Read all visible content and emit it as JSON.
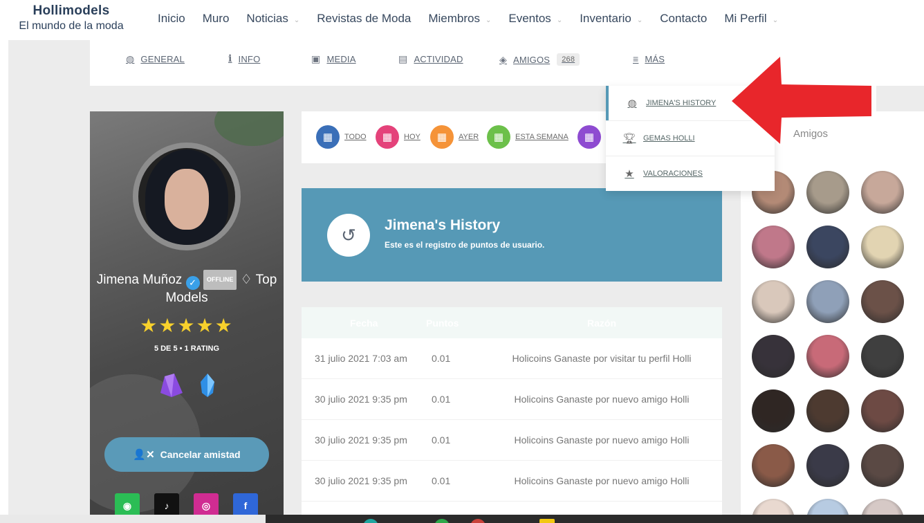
{
  "brand": {
    "title": "Hollimodels",
    "subtitle": "El mundo de la moda"
  },
  "nav": {
    "items": [
      {
        "label": "Inicio",
        "dropdown": false
      },
      {
        "label": "Muro",
        "dropdown": false
      },
      {
        "label": "Noticias",
        "dropdown": true
      },
      {
        "label": "Revistas de Moda",
        "dropdown": false
      },
      {
        "label": "Miembros",
        "dropdown": true
      },
      {
        "label": "Eventos",
        "dropdown": true
      },
      {
        "label": "Inventario",
        "dropdown": true
      },
      {
        "label": "Contacto",
        "dropdown": false
      },
      {
        "label": "Mi Perfil",
        "dropdown": true
      }
    ]
  },
  "tabs": {
    "general": "GENERAL",
    "info": "INFO",
    "media": "MEDIA",
    "actividad": "ACTIVIDAD",
    "amigos": "AMIGOS",
    "amigos_count": "268",
    "mas": "MÁS"
  },
  "profile": {
    "name": "Jimena Muñoz",
    "status": "OFFLINE",
    "group": "Top Models",
    "stars": "★★★★★",
    "rating_text": "5 DE 5  •  1 RATING",
    "cancel_button": "Cancelar amistad"
  },
  "filters": {
    "todo": "TODO",
    "hoy": "HOY",
    "ayer": "AYER",
    "esta_semana": "ESTA SEMANA"
  },
  "history": {
    "title": "Jimena's History",
    "subtitle": "Este es el registro de puntos de usuario."
  },
  "table": {
    "headers": [
      "Fecha",
      "Puntos",
      "Razón"
    ],
    "rows": [
      {
        "date": "31 julio 2021 7:03 am",
        "points": "0.01",
        "reason": "Holicoins Ganaste por visitar tu perfil Holli"
      },
      {
        "date": "30 julio 2021 9:35 pm",
        "points": "0.01",
        "reason": "Holicoins Ganaste por nuevo amigo Holli"
      },
      {
        "date": "30 julio 2021 9:35 pm",
        "points": "0.01",
        "reason": "Holicoins Ganaste por nuevo amigo Holli"
      },
      {
        "date": "30 julio 2021 9:35 pm",
        "points": "0.01",
        "reason": "Holicoins Ganaste por nuevo amigo Holli"
      }
    ]
  },
  "dropdown": {
    "items": [
      {
        "label": "Jimena's History",
        "icon": "globe-icon"
      },
      {
        "label": "Gemas Holli",
        "icon": "trophy-icon"
      },
      {
        "label": "Valoraciones",
        "icon": "star-icon"
      }
    ]
  },
  "friends": {
    "label": "Amigos",
    "avatar_colors": [
      "#b38a76",
      "#a79b8b",
      "#c7a89a",
      "#c0788a",
      "#3b4660",
      "#e2d4b2",
      "#d9c8bb",
      "#8fa0b8",
      "#6b5148",
      "#37323a",
      "#c86a78",
      "#3f3f3f",
      "#2f2623",
      "#4d3a30",
      "#6d4a44",
      "#8a5a48",
      "#3a3a48",
      "#5a4944",
      "#e9d9d0",
      "#b7cbe2",
      "#d6c9c6"
    ]
  },
  "colors": {
    "accent": "#5699b6",
    "arrow": "#e8262b",
    "filter_todo": "#3a6fb8",
    "filter_hoy": "#e4427a",
    "filter_ayer": "#f59338",
    "filter_semana": "#6cc04a",
    "filter_extra": "#8e4bd1"
  }
}
